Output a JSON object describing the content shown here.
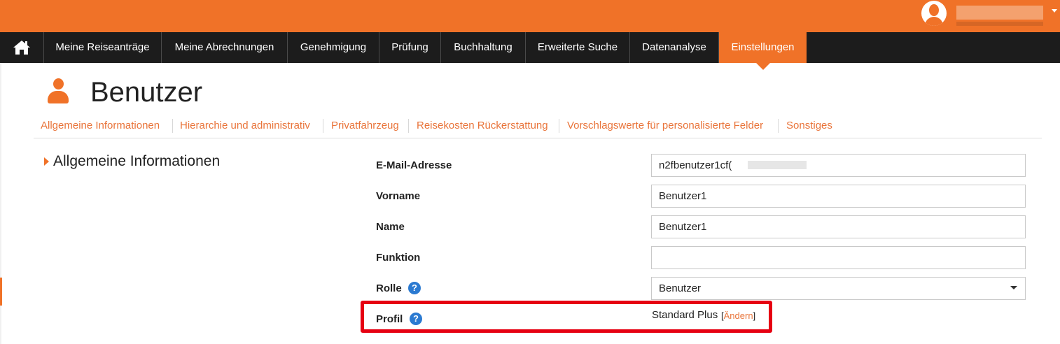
{
  "nav": {
    "items": [
      {
        "label": "Meine Reiseanträge"
      },
      {
        "label": "Meine Abrechnungen"
      },
      {
        "label": "Genehmigung"
      },
      {
        "label": "Prüfung"
      },
      {
        "label": "Buchhaltung"
      },
      {
        "label": "Erweiterte Suche"
      },
      {
        "label": "Datenanalyse"
      },
      {
        "label": "Einstellungen",
        "active": true
      }
    ]
  },
  "page": {
    "title": "Benutzer"
  },
  "subtabs": [
    {
      "label": "Allgemeine Informationen"
    },
    {
      "label": "Hierarchie und administrativ"
    },
    {
      "label": "Privatfahrzeug"
    },
    {
      "label": "Reisekosten Rückerstattung"
    },
    {
      "label": "Vorschlagswerte für personalisierte Felder"
    },
    {
      "label": "Sonstiges"
    }
  ],
  "section": {
    "title": "Allgemeine Informationen"
  },
  "form": {
    "email": {
      "label": "E-Mail-Adresse",
      "value": "n2fbenutzer1cf("
    },
    "vorname": {
      "label": "Vorname",
      "value": "Benutzer1"
    },
    "name": {
      "label": "Name",
      "value": "Benutzer1"
    },
    "funktion": {
      "label": "Funktion",
      "value": ""
    },
    "rolle": {
      "label": "Rolle",
      "value": "Benutzer"
    },
    "profil": {
      "label": "Profil",
      "value": "Standard Plus",
      "link_open": "[",
      "link_label": "Ändern",
      "link_close": "]"
    },
    "help_glyph": "?"
  },
  "icons": {
    "home": "home-icon",
    "user": "user-icon",
    "help": "help-icon",
    "caret": "caret-down-icon"
  },
  "colors": {
    "brand_orange": "#f07228",
    "nav_bg": "#1c1c1c",
    "link_orange": "#e9743a",
    "help_blue": "#2b7ad1",
    "highlight_red": "#e60012"
  }
}
